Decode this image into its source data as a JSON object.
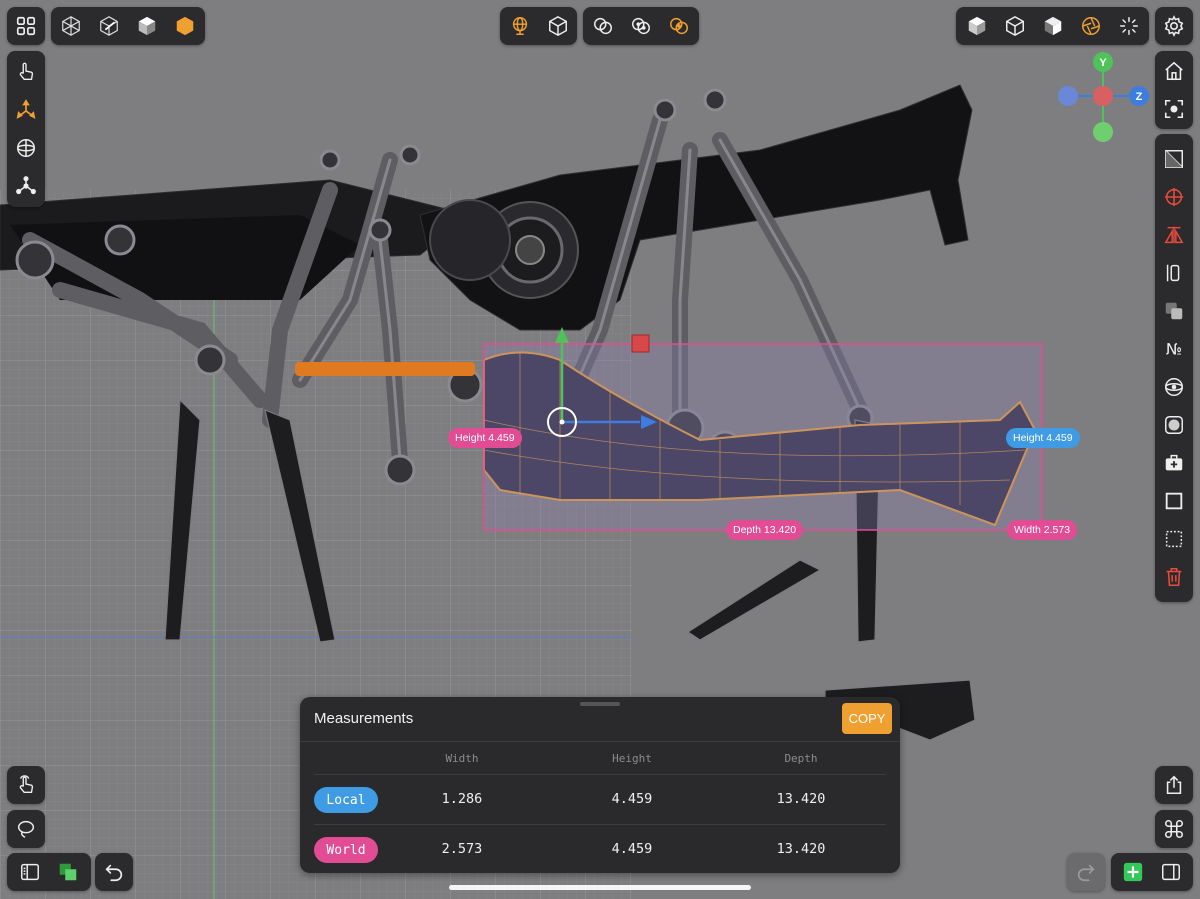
{
  "colors": {
    "accent_orange": "#f0a030",
    "local_blue": "#3e9be4",
    "world_pink": "#e24c94",
    "toolbar_bg": "#2b2b2d",
    "viewport_bg": "#7e7e80",
    "delete_red": "#e84a3c",
    "add_green": "#34c759",
    "axis_y": "#4fc25a",
    "axis_z": "#3d7de0",
    "axis_x": "#e04848"
  },
  "toolbars": {
    "top_left": [
      "grid-menu-icon"
    ],
    "view_modes": [
      "wireframe-mode-icon",
      "xray-mode-icon",
      "solid-mode-icon",
      "shaded-mode-icon"
    ],
    "top_center_a": [
      "world-sphere-icon",
      "object-cube-icon"
    ],
    "top_center_b": [
      "boolean-union-icon",
      "boolean-subtract-icon",
      "boolean-intersect-icon"
    ],
    "top_right": [
      "cube-solid-icon",
      "cube-wire-icon",
      "cube-shaded-icon",
      "aperture-icon",
      "burst-icon"
    ],
    "settings": [
      "gear-icon"
    ]
  },
  "left_tools": [
    "touch-select-icon",
    "move-gizmo-icon",
    "rotate-gizmo-icon",
    "vertex-tool-icon"
  ],
  "right_tools": [
    "home-icon",
    "focus-icon",
    "hide-icon",
    "pivot-target-icon",
    "mirror-icon",
    "align-icon",
    "duplicate-icon",
    "numeric-icon",
    "sphere-map-icon",
    "circle-shape-icon",
    "toolbox-icon",
    "square-icon",
    "dotted-square-icon",
    "trash-icon"
  ],
  "axis_gizmo": {
    "y": "Y",
    "z": "Z"
  },
  "dimension_tags": {
    "height_left": "Height 4.459",
    "height_right": "Height 4.459",
    "depth": "Depth 13.420",
    "width": "Width 2.573"
  },
  "measurements": {
    "title": "Measurements",
    "copy_label": "COPY",
    "columns": [
      "Width",
      "Height",
      "Depth"
    ],
    "rows": [
      {
        "label": "Local",
        "width": "1.286",
        "height": "4.459",
        "depth": "13.420"
      },
      {
        "label": "World",
        "width": "2.573",
        "height": "4.459",
        "depth": "13.420"
      }
    ]
  },
  "bottom_left": [
    "touch-mode-icon",
    "lasso-icon",
    "sidebar-icon",
    "layers-icon",
    "undo-icon"
  ],
  "bottom_right": [
    "share-icon",
    "command-icon",
    "redo-icon",
    "add-icon",
    "inspector-icon"
  ]
}
